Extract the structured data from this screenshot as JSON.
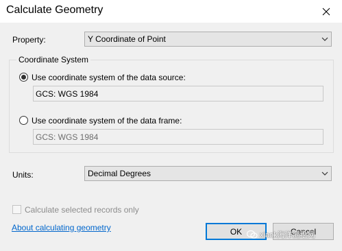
{
  "window": {
    "title": "Calculate Geometry"
  },
  "property": {
    "label": "Property:",
    "value": "Y Coordinate of Point"
  },
  "coordinate_system": {
    "group_label": "Coordinate System",
    "data_source": {
      "label": "Use coordinate system of the data source:",
      "value": "GCS: WGS 1984",
      "selected": true
    },
    "data_frame": {
      "label": "Use coordinate system of the data frame:",
      "value": "GCS: WGS 1984",
      "selected": false
    }
  },
  "units": {
    "label": "Units:",
    "value": "Decimal Degrees"
  },
  "calc_selected": {
    "label": "Calculate selected records only",
    "checked": false,
    "enabled": false
  },
  "help_link": "About calculating geometry",
  "buttons": {
    "ok": "OK",
    "cancel": "Cancel"
  },
  "watermark": "xiaok海洋测绘网",
  "colors": {
    "accent": "#0078d7",
    "link": "#0066cc"
  }
}
